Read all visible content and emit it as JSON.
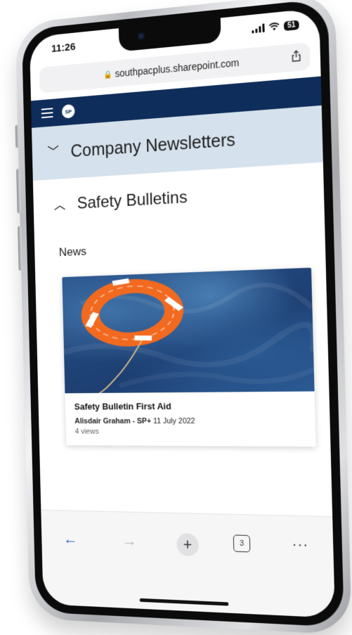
{
  "status_bar": {
    "time": "11:26",
    "battery": "51"
  },
  "browser": {
    "url": "southpacplus.sharepoint.com",
    "tab_count": "3"
  },
  "site": {
    "logo_text": "SP"
  },
  "navigation": {
    "section_title": "Company Newsletters",
    "subsection_title": "Safety Bulletins"
  },
  "news": {
    "heading": "News",
    "items": [
      {
        "title": "Safety Bulletin First Aid",
        "author": "Alisdair Graham - SP+",
        "date": "11 July 2022",
        "views": "4 views",
        "image_icon": "life-ring-on-water"
      }
    ]
  },
  "toolbar": {
    "back_icon": "arrow-left-icon",
    "forward_icon": "arrow-right-icon",
    "new_tab_icon": "plus-icon",
    "more_icon": "ellipsis-icon",
    "back_glyph": "←",
    "forward_glyph": "→",
    "plus_glyph": "+",
    "more_glyph": "···"
  },
  "colors": {
    "header_bg": "#0f2d5a",
    "band_bg": "#d5e1ec",
    "accent": "#2b62c8"
  }
}
